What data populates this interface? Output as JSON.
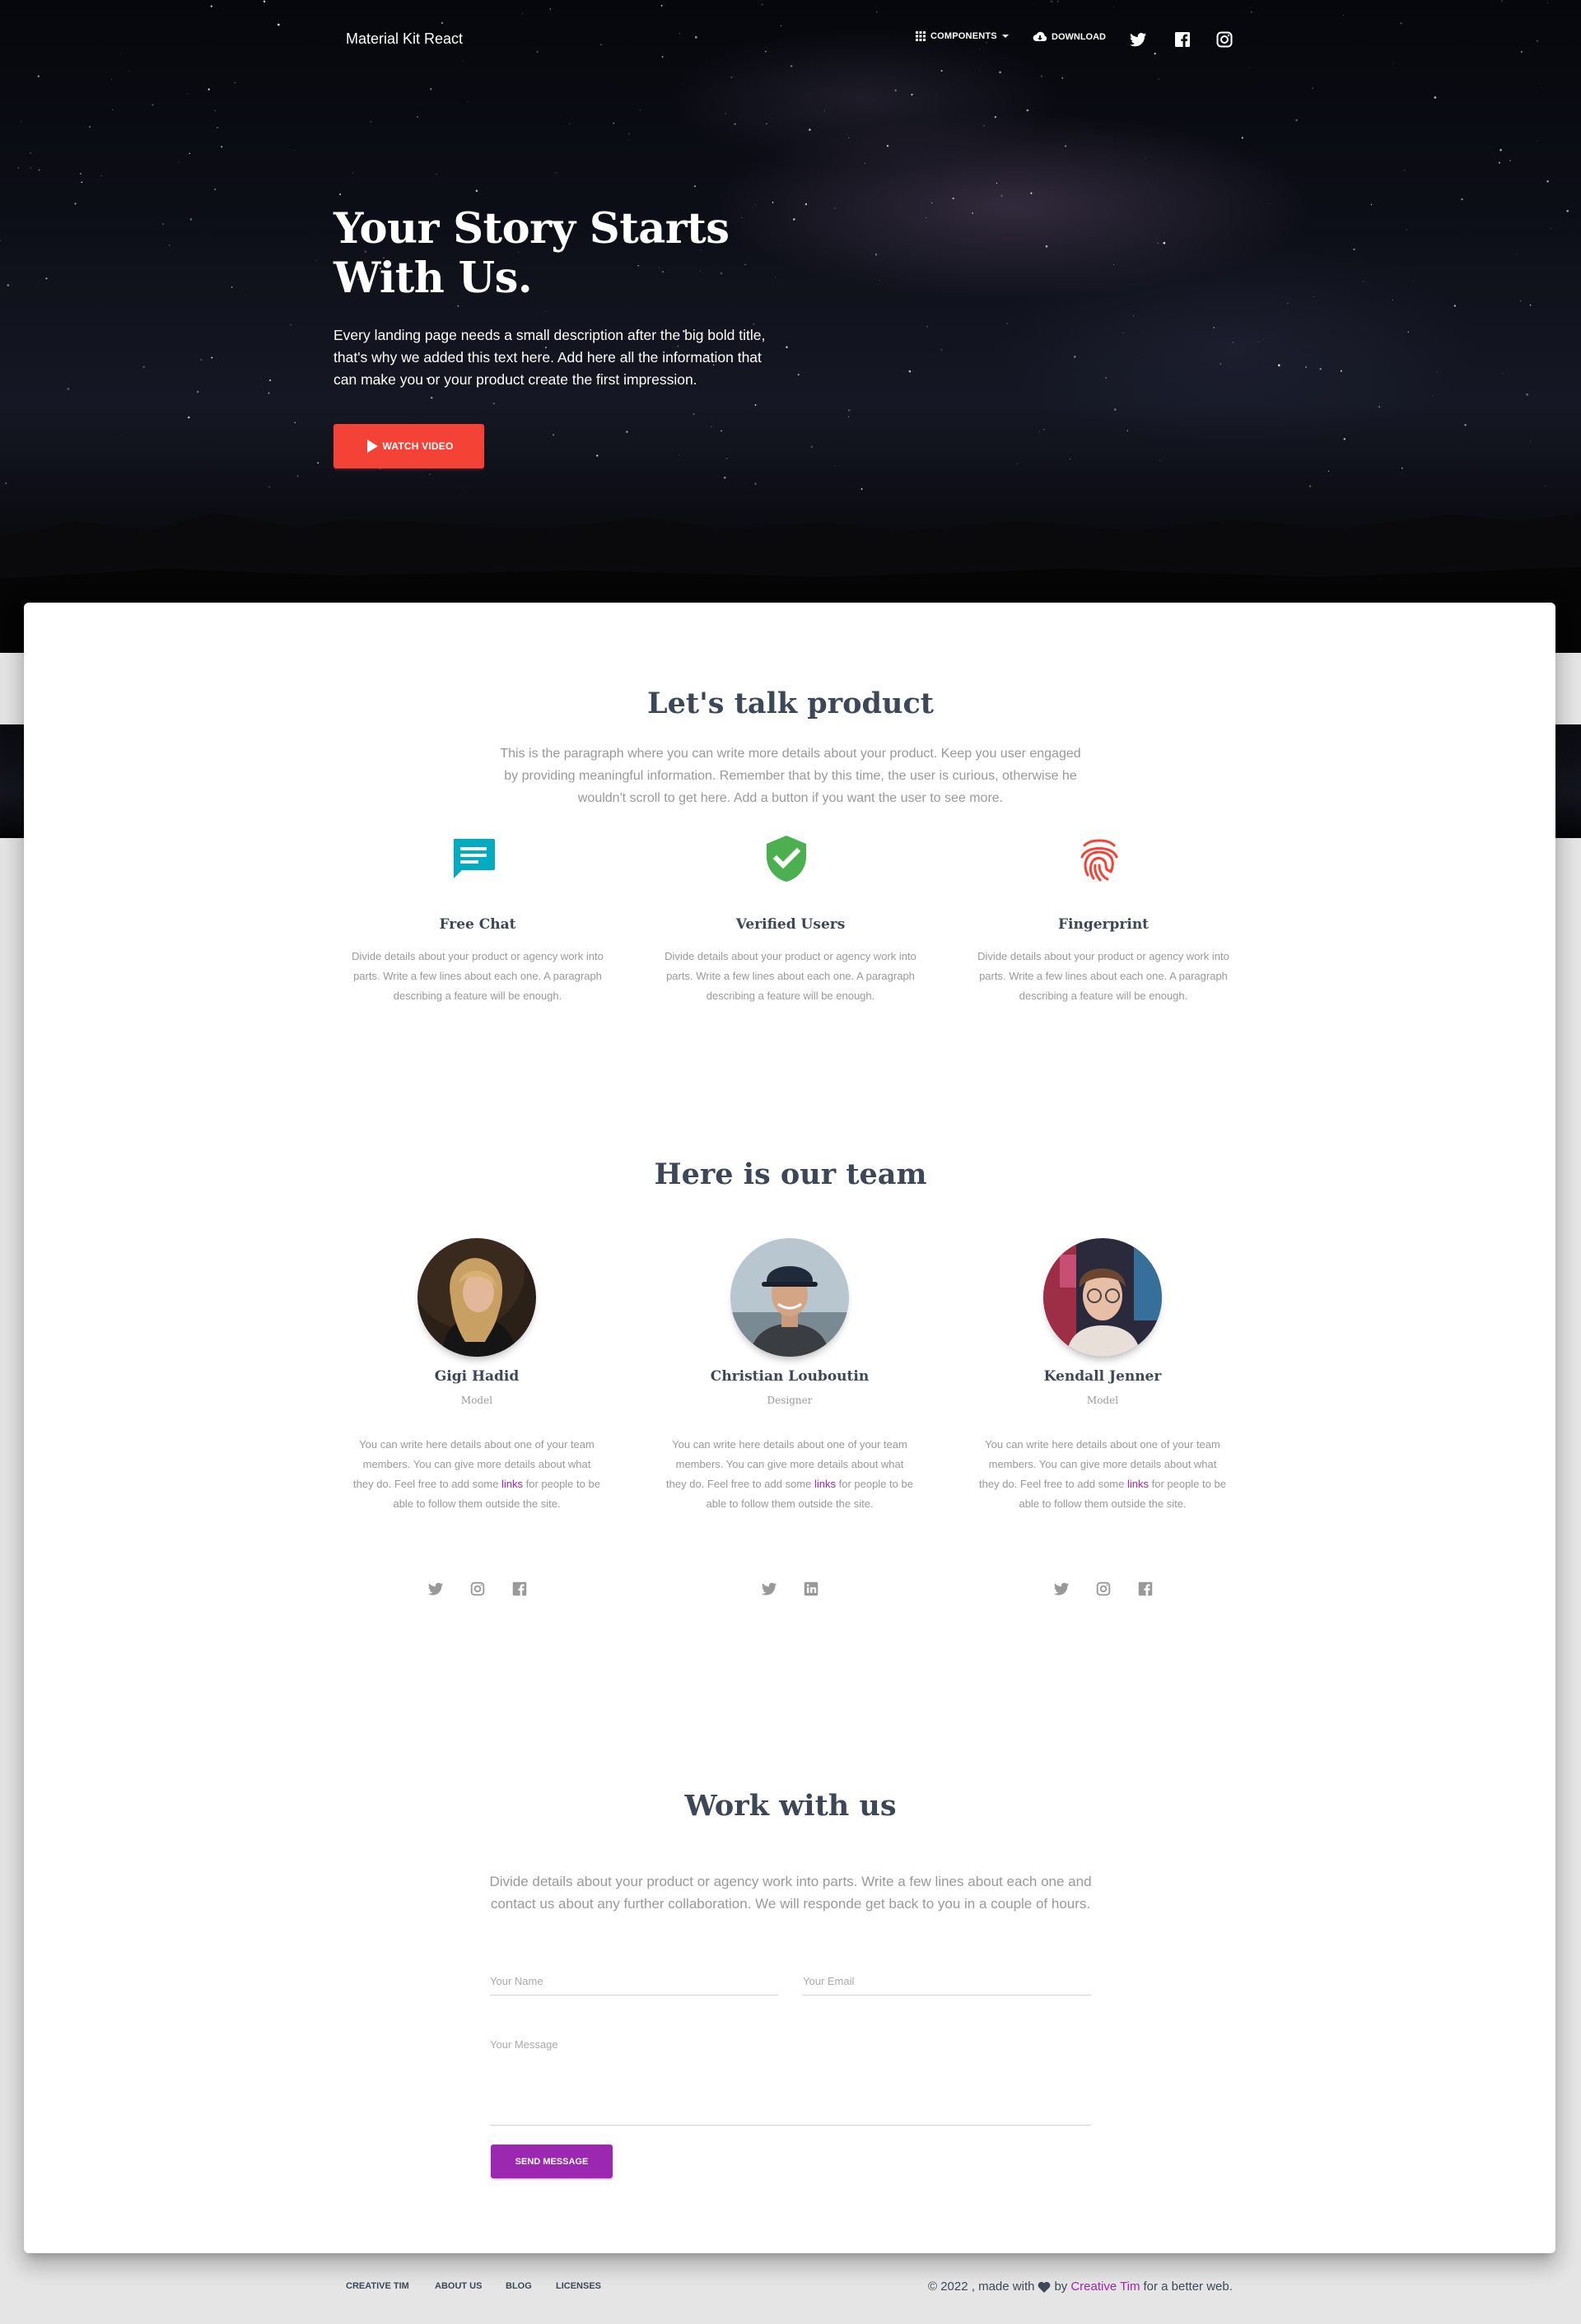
{
  "navbar": {
    "brand": "Material Kit React",
    "components_label": "COMPONENTS",
    "download_label": "DOWNLOAD",
    "social_icons": [
      "twitter-icon",
      "facebook-icon",
      "instagram-icon"
    ]
  },
  "hero": {
    "title_line1": "Your Story Starts",
    "title_line2": "With Us.",
    "description": "Every landing page needs a small description after the big bold title, that's why we added this text here. Add here all the information that can make you or your product create the first impression.",
    "button_label": "WATCH VIDEO"
  },
  "product": {
    "title": "Let's talk product",
    "description": "This is the paragraph where you can write more details about your product. Keep you user engaged by providing meaningful information. Remember that by this time, the user is curious, otherwise he wouldn't scroll to get here. Add a button if you want the user to see more.",
    "features": [
      {
        "title": "Free Chat",
        "icon": "chat-icon",
        "desc": "Divide details about your product or agency work into parts. Write a few lines about each one. A paragraph describing a feature will be enough."
      },
      {
        "title": "Verified Users",
        "icon": "verified-user-icon",
        "desc": "Divide details about your product or agency work into parts. Write a few lines about each one. A paragraph describing a feature will be enough."
      },
      {
        "title": "Fingerprint",
        "icon": "fingerprint-icon",
        "desc": "Divide details about your product or agency work into parts. Write a few lines about each one. A paragraph describing a feature will be enough."
      }
    ],
    "colors": {
      "info": "#00acc1",
      "success": "#4caf50",
      "danger": "#f44336"
    }
  },
  "team": {
    "title": "Here is our team",
    "members": [
      {
        "name": "Gigi Hadid",
        "role": "Model",
        "desc_before": "You can write here details about one of your team members. You can give more details about what they do. Feel free to add some ",
        "link": "links",
        "desc_after": " for people to be able to follow them outside the site.",
        "socials": [
          "twitter-icon",
          "instagram-icon",
          "facebook-icon"
        ]
      },
      {
        "name": "Christian Louboutin",
        "role": "Designer",
        "desc_before": "You can write here details about one of your team members. You can give more details about what they do. Feel free to add some ",
        "link": "links",
        "desc_after": " for people to be able to follow them outside the site.",
        "socials": [
          "twitter-icon",
          "linkedin-icon"
        ]
      },
      {
        "name": "Kendall Jenner",
        "role": "Model",
        "desc_before": "You can write here details about one of your team members. You can give more details about what they do. Feel free to add some ",
        "link": "links",
        "desc_after": " for people to be able to follow them outside the site.",
        "socials": [
          "twitter-icon",
          "instagram-icon",
          "facebook-icon"
        ]
      }
    ]
  },
  "work": {
    "title": "Work with us",
    "description": "Divide details about your product or agency work into parts. Write a few lines about each one and contact us about any further collaboration. We will responde get back to you in a couple of hours.",
    "name_placeholder": "Your Name",
    "email_placeholder": "Your Email",
    "message_placeholder": "Your Message",
    "button_label": "SEND MESSAGE"
  },
  "footer": {
    "links": [
      "CREATIVE TIM",
      "ABOUT US",
      "BLOG",
      "LICENSES"
    ],
    "copyright_prefix": "© 2022 , made with",
    "copyright_by": "by",
    "copyright_brand": "Creative Tim",
    "copyright_suffix": "for a better web."
  }
}
